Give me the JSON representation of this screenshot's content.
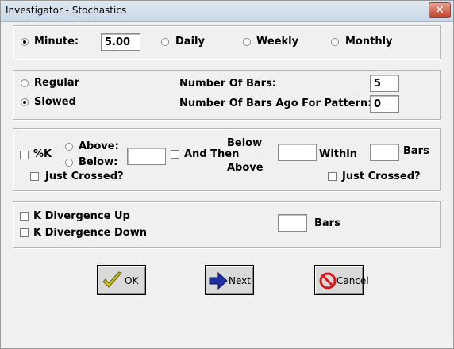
{
  "window": {
    "title": "Investigator - Stochastics"
  },
  "timeframe": {
    "minute_label": "Minute:",
    "minute_value": "5.00",
    "daily_label": "Daily",
    "weekly_label": "Weekly",
    "monthly_label": "Monthly",
    "selected": "Minute"
  },
  "mode": {
    "regular_label": "Regular",
    "slowed_label": "Slowed",
    "selected": "Slowed",
    "num_bars_label": "Number Of Bars:",
    "num_bars_value": "5",
    "bars_ago_label": "Number Of Bars Ago For Pattern:",
    "bars_ago_value": "0"
  },
  "pattern": {
    "pk_label": "%K",
    "above_label": "Above:",
    "below_label": "Below:",
    "level_value": "",
    "and_then_label": "And Then",
    "below_word": "Below",
    "above_word": "Above",
    "second_value": "",
    "within_label": "Within",
    "within_value": "",
    "bars_label": "Bars",
    "just_crossed_1": "Just Crossed?",
    "just_crossed_2": "Just Crossed?"
  },
  "divergence": {
    "up_label": "K Divergence Up",
    "down_label": "K Divergence Down",
    "bars_value": "",
    "bars_label": "Bars"
  },
  "buttons": {
    "ok": "OK",
    "next": "Next",
    "cancel": "Cancel"
  },
  "colors": {
    "check_icon": "#d4c21a",
    "next_arrow": "#1f2fa6",
    "cancel_icon": "#d31a1a"
  }
}
